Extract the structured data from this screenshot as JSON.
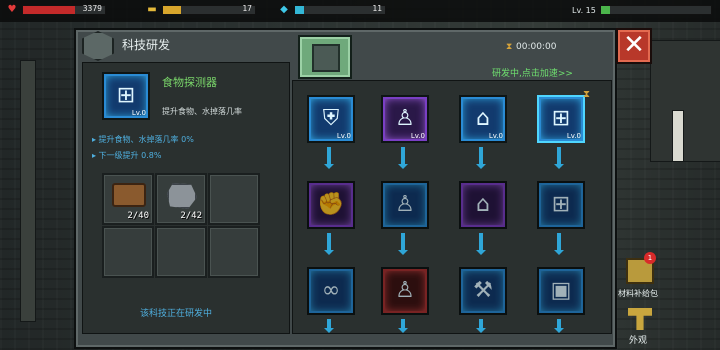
{
  "status_bar": {
    "health_value": "3379",
    "food_value": "17",
    "water_value": "11",
    "level_label": "Lv. 15"
  },
  "panel": {
    "title": "科技研发",
    "timer": "00:00:00",
    "research_status": "研发中,点击加速>>",
    "close_symbol": "✕"
  },
  "detail": {
    "tech_name": "食物探测器",
    "tech_desc": "提升食物、水掉落几率",
    "tech_level": "Lv.0",
    "effect_current": "▸ 提升食物、水掉落几率 0%",
    "effect_next": "▸ 下一级提升 0.8%",
    "materials": [
      {
        "name": "wood",
        "count": "2/40"
      },
      {
        "name": "iron-ore",
        "count": "2/42"
      }
    ],
    "footer": "该科技正在研发中"
  },
  "tech_tree": {
    "row1_levels": [
      "Lv.0",
      "Lv.0",
      "Lv.0",
      "Lv.0"
    ]
  },
  "sidebar": {
    "supply_label": "材料补给包",
    "supply_badge": "1",
    "appearance_label": "外观"
  },
  "colors": {
    "accent_green": "#6fe06f",
    "accent_blue": "#2fa6d8",
    "close_red": "#b8382a"
  }
}
